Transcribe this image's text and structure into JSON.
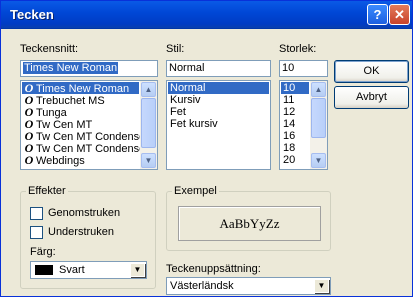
{
  "window": {
    "title": "Tecken",
    "help_glyph": "?",
    "close_glyph": "✕"
  },
  "font": {
    "label": "Teckensnitt:",
    "value": "Times New Roman",
    "items": [
      {
        "label": "Times New Roman",
        "selected": true
      },
      {
        "label": "Trebuchet MS",
        "selected": false
      },
      {
        "label": "Tunga",
        "selected": false
      },
      {
        "label": "Tw Cen MT",
        "selected": false
      },
      {
        "label": "Tw Cen MT Condense",
        "selected": false
      },
      {
        "label": "Tw Cen MT Condense",
        "selected": false
      },
      {
        "label": "Webdings",
        "selected": false
      }
    ],
    "icon_glyph": "O"
  },
  "style": {
    "label": "Stil:",
    "value": "Normal",
    "items": [
      {
        "label": "Normal",
        "selected": true
      },
      {
        "label": "Kursiv",
        "selected": false
      },
      {
        "label": "Fet",
        "selected": false
      },
      {
        "label": "Fet kursiv",
        "selected": false
      }
    ]
  },
  "size": {
    "label": "Storlek:",
    "value": "10",
    "items": [
      {
        "label": "10",
        "selected": true
      },
      {
        "label": "11",
        "selected": false
      },
      {
        "label": "12",
        "selected": false
      },
      {
        "label": "14",
        "selected": false
      },
      {
        "label": "16",
        "selected": false
      },
      {
        "label": "18",
        "selected": false
      },
      {
        "label": "20",
        "selected": false
      }
    ]
  },
  "buttons": {
    "ok": "OK",
    "cancel": "Avbryt"
  },
  "effects": {
    "title": "Effekter",
    "strikeout": "Genomstruken",
    "underline": "Understruken",
    "color_label": "Färg:",
    "color_value": "Svart"
  },
  "sample": {
    "title": "Exempel",
    "text": "AaBbYyZz"
  },
  "charset": {
    "label": "Teckenuppsättning:",
    "value": "Västerländsk"
  },
  "arrows": {
    "up": "▲",
    "down": "▼"
  }
}
